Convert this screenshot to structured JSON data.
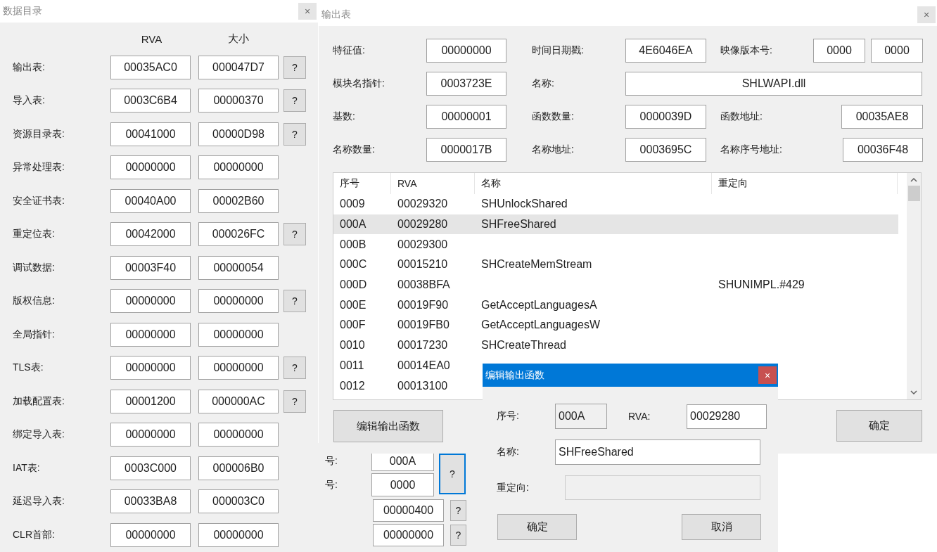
{
  "back_window": {
    "rows": [
      {
        "label": "号:",
        "value": "000A",
        "help": "?"
      },
      {
        "label": "号:",
        "value": "0000"
      },
      {
        "value": "00000400",
        "help": "?"
      },
      {
        "value": "00000000",
        "help": "?"
      }
    ]
  },
  "data_directory": {
    "title": "数据目录",
    "close": "×",
    "columns": [
      "RVA",
      "大小"
    ],
    "rows": [
      {
        "label": "输出表:",
        "rva": "00035AC0",
        "size": "000047D7",
        "help": "?"
      },
      {
        "label": "导入表:",
        "rva": "0003C6B4",
        "size": "00000370",
        "help": "?"
      },
      {
        "label": "资源目录表:",
        "rva": "00041000",
        "size": "00000D98",
        "help": "?"
      },
      {
        "label": "异常处理表:",
        "rva": "00000000",
        "size": "00000000"
      },
      {
        "label": "安全证书表:",
        "rva": "00040A00",
        "size": "00002B60"
      },
      {
        "label": "重定位表:",
        "rva": "00042000",
        "size": "000026FC",
        "help": "?"
      },
      {
        "label": "调试数据:",
        "rva": "00003F40",
        "size": "00000054"
      },
      {
        "label": "版权信息:",
        "rva": "00000000",
        "size": "00000000",
        "help": "?"
      },
      {
        "label": "全局指针:",
        "rva": "00000000",
        "size": "00000000"
      },
      {
        "label": "TLS表:",
        "rva": "00000000",
        "size": "00000000",
        "help": "?"
      },
      {
        "label": "加载配置表:",
        "rva": "00001200",
        "size": "000000AC",
        "help": "?"
      },
      {
        "label": "绑定导入表:",
        "rva": "00000000",
        "size": "00000000"
      },
      {
        "label": "IAT表:",
        "rva": "0003C000",
        "size": "000006B0"
      },
      {
        "label": "延迟导入表:",
        "rva": "00033BA8",
        "size": "000003C0"
      },
      {
        "label": "CLR首部:",
        "rva": "00000000",
        "size": "00000000"
      }
    ]
  },
  "export_table": {
    "title": "输出表",
    "close": "×",
    "fields": [
      {
        "label": "特征值:",
        "values": [
          "00000000"
        ]
      },
      {
        "label": "时间日期戳:",
        "values": [
          "4E6046EA"
        ]
      },
      {
        "label": "映像版本号:",
        "values": [
          "0000",
          "0000"
        ]
      },
      {
        "label": "模块名指针:",
        "values": [
          "0003723E"
        ]
      },
      {
        "label": "名称:",
        "values": [
          "SHLWAPI.dll"
        ]
      },
      {
        "label": "基数:",
        "values": [
          "00000001"
        ]
      },
      {
        "label": "函数数量:",
        "values": [
          "0000039D"
        ]
      },
      {
        "label": "函数地址:",
        "values": [
          "00035AE8"
        ]
      },
      {
        "label": "名称数量:",
        "values": [
          "0000017B"
        ]
      },
      {
        "label": "名称地址:",
        "values": [
          "0003695C"
        ]
      },
      {
        "label": "名称序号地址:",
        "values": [
          "00036F48"
        ]
      }
    ],
    "columns": [
      "序号",
      "RVA",
      "名称",
      "重定向"
    ],
    "rows": [
      {
        "cells": [
          "0009",
          "00029320",
          "SHUnlockShared",
          ""
        ],
        "selected": false
      },
      {
        "cells": [
          "000A",
          "00029280",
          "SHFreeShared",
          ""
        ],
        "selected": true
      },
      {
        "cells": [
          "000B",
          "00029300",
          "",
          ""
        ],
        "selected": false
      },
      {
        "cells": [
          "000C",
          "00015210",
          "SHCreateMemStream",
          ""
        ],
        "selected": false
      },
      {
        "cells": [
          "000D",
          "00038BFA",
          "",
          "SHUNIMPL.#429"
        ],
        "selected": false
      },
      {
        "cells": [
          "000E",
          "00019F90",
          "GetAcceptLanguagesA",
          ""
        ],
        "selected": false
      },
      {
        "cells": [
          "000F",
          "00019FB0",
          "GetAcceptLanguagesW",
          ""
        ],
        "selected": false
      },
      {
        "cells": [
          "0010",
          "00017230",
          "SHCreateThread",
          ""
        ],
        "selected": false
      },
      {
        "cells": [
          "0011",
          "00014EA0",
          "",
          ""
        ],
        "selected": false
      },
      {
        "cells": [
          "0012",
          "00013100",
          "",
          ""
        ],
        "selected": false
      }
    ],
    "buttons": [
      "编辑输出函数",
      "确定"
    ]
  },
  "edit_dialog": {
    "title": "编辑输出函数",
    "close": "×",
    "ordinal_label": "序号:",
    "ordinal": "000A",
    "rva_label": "RVA:",
    "rva": "00029280",
    "name_label": "名称:",
    "name": "SHFreeShared",
    "redirect_label": "重定向:",
    "redirect_disabled": true,
    "buttons": [
      "确定",
      "取消"
    ]
  }
}
